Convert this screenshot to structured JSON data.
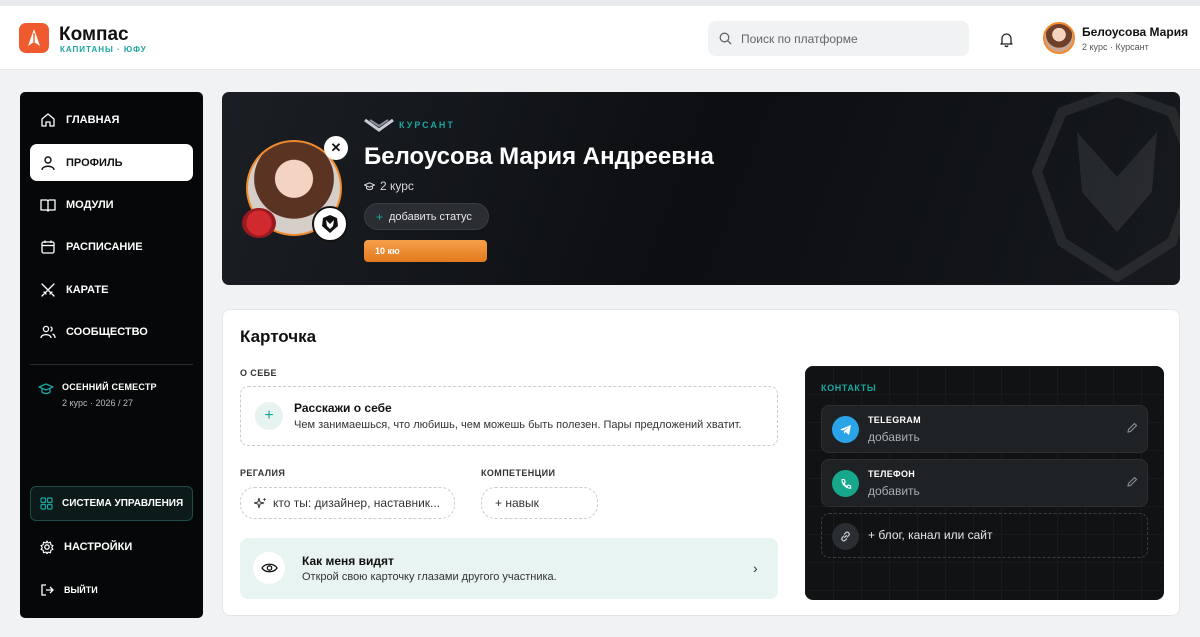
{
  "header": {
    "brand": "Компас",
    "brand_sub": "КАПИТАНЫ · ЮФУ",
    "search_placeholder": "Поиск по платформе",
    "user_name": "Белоусова Мария",
    "user_sub": "2 курс · Курсант"
  },
  "sidebar": {
    "items": [
      {
        "label": "ГЛАВНАЯ",
        "icon": "home-icon"
      },
      {
        "label": "ПРОФИЛЬ",
        "icon": "user-icon",
        "active": true
      },
      {
        "label": "МОДУЛИ",
        "icon": "book-icon"
      },
      {
        "label": "РАСПИСАНИЕ",
        "icon": "calendar-icon"
      },
      {
        "label": "КАРАТЕ",
        "icon": "crossed-swords-icon"
      },
      {
        "label": "СООБЩЕСТВО",
        "icon": "people-icon"
      }
    ],
    "semester_title": "ОСЕННИЙ СЕМЕСТР",
    "semester_sub": "2 курс · 2026 / 27",
    "system_button": "СИСТЕМА УПРАВЛЕНИЯ",
    "settings": "НАСТРОЙКИ",
    "logout": "ВЫЙТИ"
  },
  "hero": {
    "rank": "КУРСАНТ",
    "full_name": "Белоусова Мария Андреевна",
    "course": "2 курс",
    "status_button": "добавить статус",
    "kyu": "10 кю",
    "kyu_progress": 1.0
  },
  "card": {
    "title": "Карточка",
    "about_label": "О СЕБЕ",
    "about_title": "Расскажи о себе",
    "about_sub": "Чем занимаешься, что любишь, чем можешь быть полезен. Пары предложений хватит.",
    "regalia_label": "РЕГАЛИЯ",
    "regalia_placeholder": "кто ты: дизайнер, наставник...",
    "competencies_label": "КОМПЕТЕНЦИИ",
    "skill_button": "+ навык",
    "seen_title": "Как меня видят",
    "seen_sub": "Открой свою карточку глазами другого участника."
  },
  "contacts": {
    "label": "КОНТАКТЫ",
    "telegram_title": "TELEGRAM",
    "telegram_value": "добавить",
    "phone_title": "ТЕЛЕФОН",
    "phone_value": "добавить",
    "link_add": "+ блог, канал или сайт"
  },
  "colors": {
    "accent": "#1aa6a0",
    "orange": "#ef5b2e",
    "kyu": "#f08a2c",
    "telegram": "#2aa3e8",
    "phone": "#17a88c"
  }
}
